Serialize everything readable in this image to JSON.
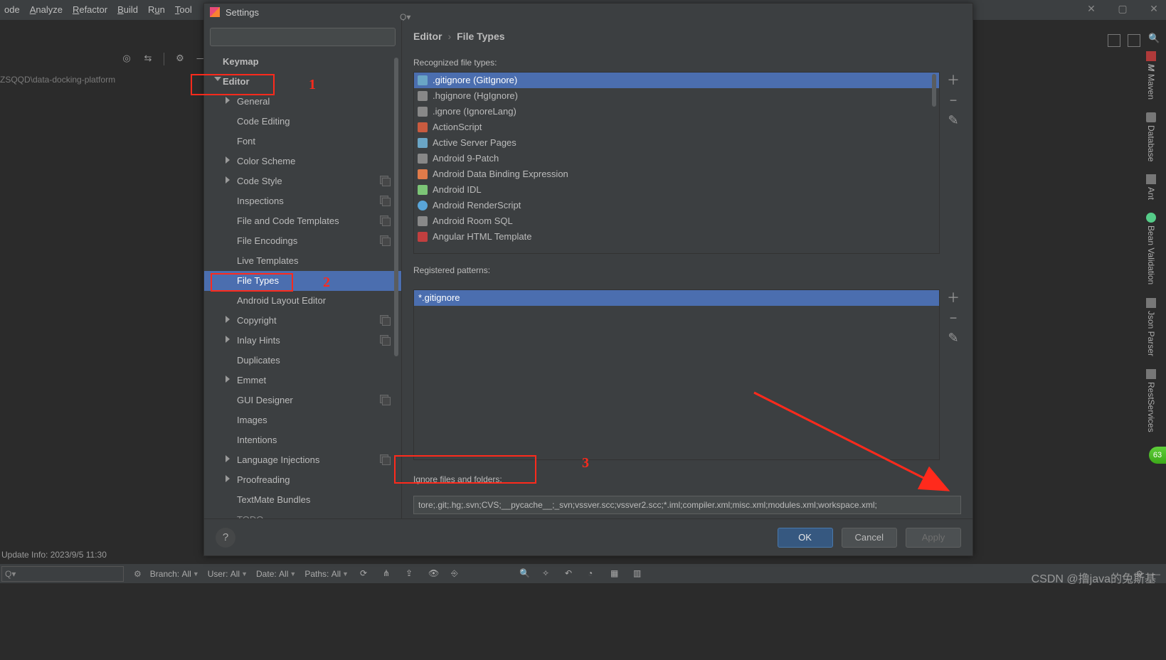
{
  "menubar": {
    "items": [
      "ode",
      "Analyze",
      "Refactor",
      "Build",
      "Run",
      "Tool"
    ]
  },
  "dialog": {
    "title": "Settings",
    "window_actions": {
      "close": "✕",
      "restore": "▢",
      "minimize": "—"
    },
    "search_placeholder": "",
    "tree": {
      "items": [
        {
          "label": "Keymap",
          "level": 1
        },
        {
          "label": "Editor",
          "level": 1,
          "expanded": true,
          "bold": true
        },
        {
          "label": "General",
          "level": 2,
          "expandable": true
        },
        {
          "label": "Code Editing",
          "level": 2
        },
        {
          "label": "Font",
          "level": 2
        },
        {
          "label": "Color Scheme",
          "level": 2,
          "expandable": true
        },
        {
          "label": "Code Style",
          "level": 2,
          "expandable": true,
          "copy": true
        },
        {
          "label": "Inspections",
          "level": 2,
          "copy": true
        },
        {
          "label": "File and Code Templates",
          "level": 2,
          "copy": true
        },
        {
          "label": "File Encodings",
          "level": 2,
          "copy": true
        },
        {
          "label": "Live Templates",
          "level": 2
        },
        {
          "label": "File Types",
          "level": 2,
          "selected": true
        },
        {
          "label": "Android Layout Editor",
          "level": 2
        },
        {
          "label": "Copyright",
          "level": 2,
          "expandable": true,
          "copy": true
        },
        {
          "label": "Inlay Hints",
          "level": 2,
          "expandable": true,
          "copy": true
        },
        {
          "label": "Duplicates",
          "level": 2
        },
        {
          "label": "Emmet",
          "level": 2,
          "expandable": true
        },
        {
          "label": "GUI Designer",
          "level": 2,
          "copy": true
        },
        {
          "label": "Images",
          "level": 2
        },
        {
          "label": "Intentions",
          "level": 2
        },
        {
          "label": "Language Injections",
          "level": 2,
          "expandable": true,
          "copy": true
        },
        {
          "label": "Proofreading",
          "level": 2,
          "expandable": true
        },
        {
          "label": "TextMate Bundles",
          "level": 2
        },
        {
          "label": "TODO",
          "level": 2
        }
      ]
    },
    "right": {
      "breadcrumb": {
        "root": "Editor",
        "leaf": "File Types"
      },
      "section_recognized": "Recognized file types:",
      "filetypes": [
        ".gitignore (GitIgnore)",
        ".hgignore (HgIgnore)",
        ".ignore (IgnoreLang)",
        "ActionScript",
        "Active Server Pages",
        "Android 9-Patch",
        "Android Data Binding Expression",
        "Android IDL",
        "Android RenderScript",
        "Android Room SQL",
        "Angular HTML Template"
      ],
      "filetypes_selected_index": 0,
      "section_patterns": "Registered patterns:",
      "patterns": [
        "*.gitignore"
      ],
      "ignore_label": "Ignore files and folders:",
      "ignore_value": "tore;.git;.hg;.svn;CVS;__pycache__;_svn;vssver.scc;vssver2.scc;*.iml;compiler.xml;misc.xml;modules.xml;workspace.xml;"
    },
    "footer": {
      "help": "?",
      "ok": "OK",
      "cancel": "Cancel",
      "apply": "Apply"
    }
  },
  "ide": {
    "breadcrumb": "ZSQQD\\data-docking-platform",
    "update_info": "Update Info: 2023/9/5 11:30",
    "search2": "Q▾",
    "status": {
      "branch_label": "Branch:",
      "branch_value": "All",
      "user_label": "User:",
      "user_value": "All",
      "date_label": "Date:",
      "date_value": "All",
      "paths_label": "Paths:",
      "paths_value": "All"
    },
    "right_tools": [
      "Maven",
      "Database",
      "Ant",
      "Bean Validation",
      "Json Parser",
      "RestServices"
    ],
    "green_badge": "63"
  },
  "annotations": {
    "a1": "1",
    "a2": "2",
    "a3": "3"
  },
  "watermark": "CSDN @撸java的兔斯基"
}
